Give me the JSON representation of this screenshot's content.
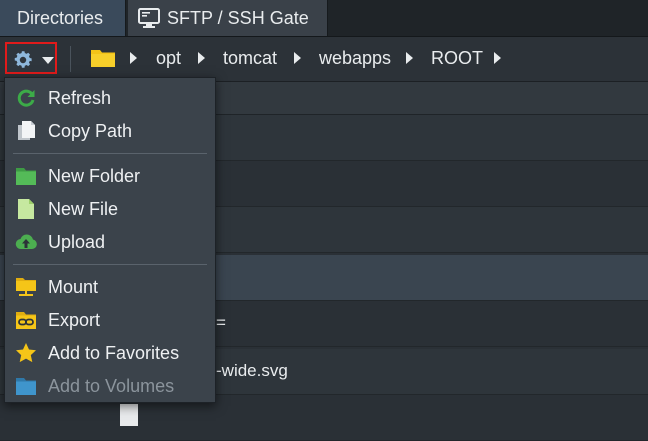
{
  "tabs": [
    {
      "label": "Directories",
      "active": true
    },
    {
      "label": "SFTP / SSH Gate",
      "active": false,
      "icon": "monitor-icon"
    }
  ],
  "breadcrumb": {
    "root_icon": "folder-icon",
    "items": [
      "opt",
      "tomcat",
      "webapps",
      "ROOT"
    ]
  },
  "gear_menu": {
    "icon": "gear-icon",
    "highlight_color": "#e11b1b",
    "items": [
      {
        "label": "Refresh",
        "icon": "refresh-icon",
        "enabled": true
      },
      {
        "label": "Copy Path",
        "icon": "copy-icon",
        "enabled": true
      },
      {
        "label": "New Folder",
        "icon": "new-folder-icon",
        "enabled": true
      },
      {
        "label": "New File",
        "icon": "new-file-icon",
        "enabled": true
      },
      {
        "label": "Upload",
        "icon": "upload-icon",
        "enabled": true
      },
      {
        "label": "Mount",
        "icon": "mount-icon",
        "enabled": true
      },
      {
        "label": "Export",
        "icon": "export-icon",
        "enabled": true
      },
      {
        "label": "Add to Favorites",
        "icon": "star-icon",
        "enabled": true
      },
      {
        "label": "Add to Volumes",
        "icon": "volumes-icon",
        "enabled": false
      }
    ]
  },
  "file_list": {
    "visible_fragments": [
      "=",
      "-wide.svg"
    ]
  }
}
